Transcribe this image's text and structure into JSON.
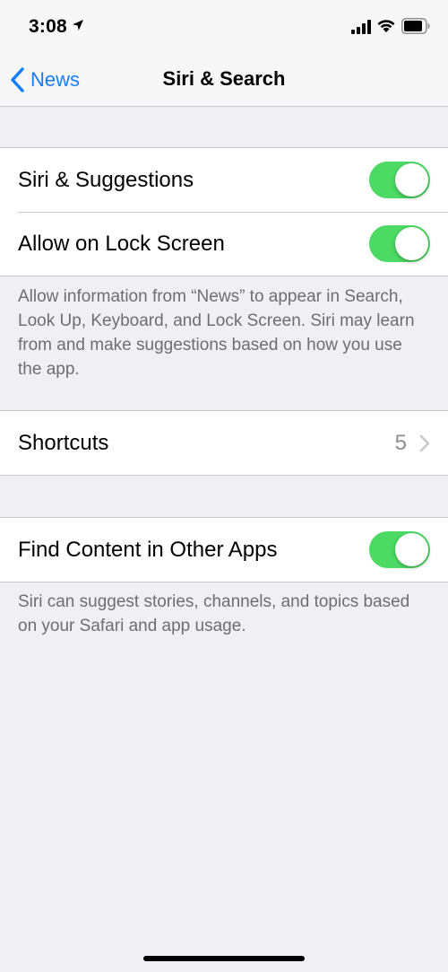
{
  "status_bar": {
    "time": "3:08",
    "icons": [
      "location-arrow-icon",
      "cellular-signal-icon",
      "wifi-icon",
      "battery-icon"
    ]
  },
  "nav": {
    "back_label": "News",
    "title": "Siri & Search"
  },
  "section1": {
    "rows": [
      {
        "label": "Siri & Suggestions",
        "toggle_on": true
      },
      {
        "label": "Allow on Lock Screen",
        "toggle_on": true
      }
    ],
    "footer": "Allow information from “News” to appear in Search, Look Up, Keyboard, and Lock Screen. Siri may learn from and make suggestions based on how you use the app."
  },
  "section2": {
    "shortcuts_label": "Shortcuts",
    "shortcuts_count": "5"
  },
  "section3": {
    "rows": [
      {
        "label": "Find Content in Other Apps",
        "toggle_on": true
      }
    ],
    "footer": "Siri can suggest stories, channels, and topics based on your Safari and app usage."
  },
  "colors": {
    "accent_blue": "#147efb",
    "toggle_green": "#4cd964",
    "background": "#efeff4",
    "secondary_text": "#6d6d72"
  }
}
